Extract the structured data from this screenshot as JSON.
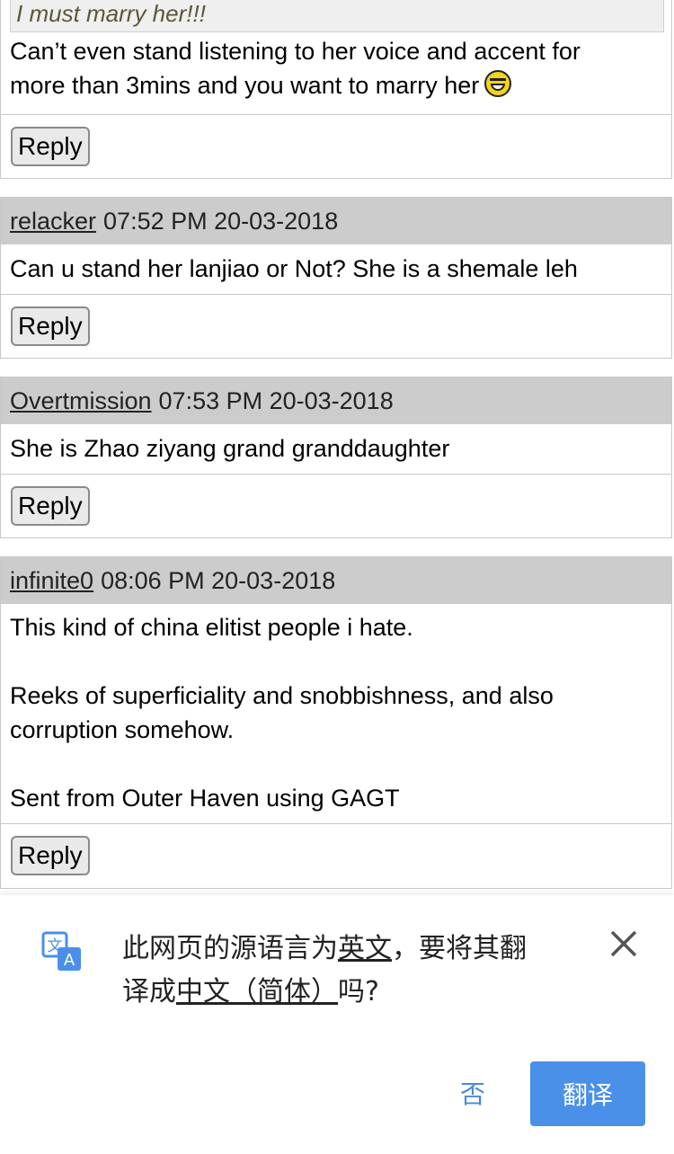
{
  "posts": [
    {
      "quote": "I must marry her!!!",
      "body_lines": [
        "Can’t even stand listening to her voice and accent for",
        "more than 3mins and you want to marry her"
      ],
      "emoji": "grinning-face-icon",
      "reply": "Reply"
    },
    {
      "user": "relacker",
      "time": "07:52 PM 20-03-2018",
      "body_lines": [
        "Can u stand her lanjiao or Not? She is a shemale leh"
      ],
      "reply": "Reply"
    },
    {
      "user": "Overtmission",
      "time": "07:53 PM 20-03-2018",
      "body_lines": [
        "She is Zhao ziyang grand granddaughter"
      ],
      "reply": "Reply"
    },
    {
      "user": "infinite0",
      "time": "08:06 PM 20-03-2018",
      "body_lines": [
        "This kind of china elitist people i hate.",
        "",
        "Reeks of superficiality and snobbishness, and also",
        "corruption somehow.",
        "",
        "Sent from Outer Haven using GAGT"
      ],
      "reply": "Reply"
    }
  ],
  "translate": {
    "icon": "translate-icon",
    "line1_pre": "此网页的源语言为",
    "line1_link": "英文",
    "line1_post": "，要将其翻",
    "line2_pre": "译成",
    "line2_link": "中文（简体）",
    "line2_post": "吗?",
    "no_label": "否",
    "yes_label": "翻译",
    "close_icon": "close-icon",
    "accent_color": "#4a90e8"
  }
}
